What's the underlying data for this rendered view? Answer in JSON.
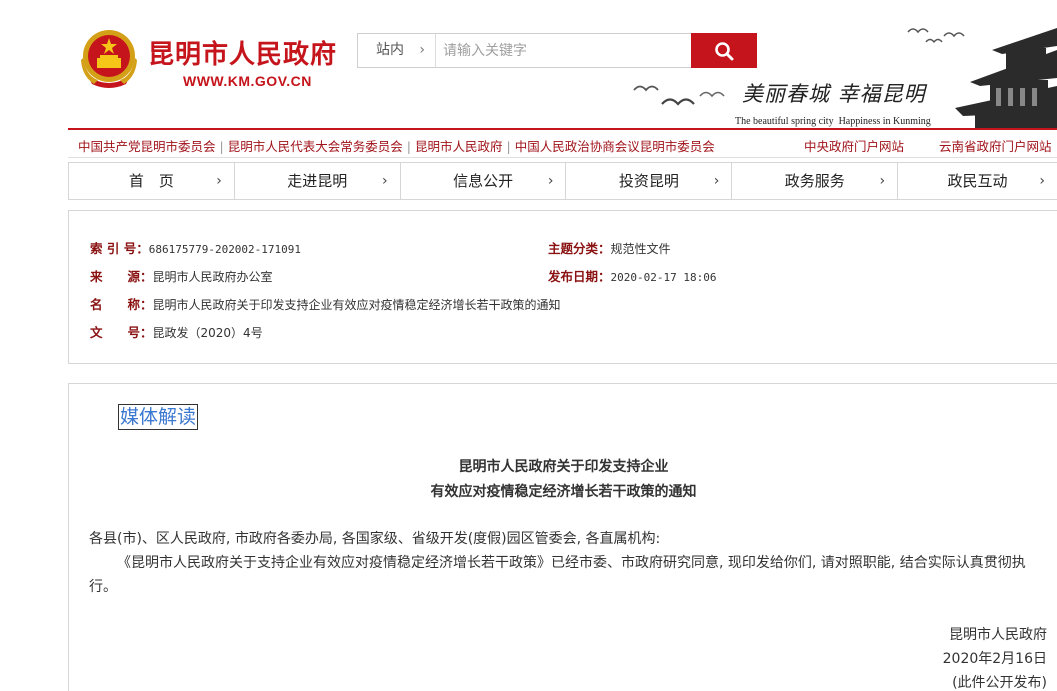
{
  "header": {
    "site_title": "昆明市人民政府",
    "site_url": "WWW.KM.GOV.CN",
    "search": {
      "scope": "站内",
      "placeholder": "请输入关键字"
    },
    "slogan_cn": "美丽春城  幸福昆明",
    "slogan_en": "The beautiful spring city  Happiness in Kunming"
  },
  "toplinks": {
    "left": [
      "中国共产党昆明市委员会",
      "昆明市人民代表大会常务委员会",
      "昆明市人民政府",
      "中国人民政治协商会议昆明市委员会"
    ],
    "right": [
      "中央政府门户网站",
      "云南省政府门户网站"
    ]
  },
  "nav": [
    "首　页",
    "走进昆明",
    "信息公开",
    "投资昆明",
    "政务服务",
    "政民互动"
  ],
  "info": {
    "index_label": "索 引 号：",
    "index_value": "686175779-202002-171091",
    "topic_label": "主题分类：",
    "topic_value": "规范性文件",
    "source_label": "来　　源：",
    "source_value": "昆明市人民政府办公室",
    "date_label": "发布日期：",
    "date_value": "2020-02-17 18:06",
    "name_label": "名　　称：",
    "name_value": "昆明市人民政府关于印发支持企业有效应对疫情稳定经济增长若干政策的通知",
    "doc_label": "文　　号：",
    "doc_value": "昆政发（2020）4号"
  },
  "article": {
    "media_link": "媒体解读",
    "title_line1": "昆明市人民政府关于印发支持企业",
    "title_line2": "有效应对疫情稳定经济增长若干政策的通知",
    "recipients": "各县(市)、区人民政府, 市政府各委办局, 各国家级、省级开发(度假)园区管委会, 各直属机构:",
    "body_line1": "《昆明市人民政府关于支持企业有效应对疫情稳定经济增长若干政策》已经市委、市政府研究同意, 现印发给你们, 请对照职能, 结合实际认真贯彻执",
    "body_line2": "行。",
    "sign_org": "昆明市人民政府",
    "sign_date": "2020年2月16日",
    "sign_note": "(此件公开发布)"
  },
  "colors": {
    "brand_red": "#c5141b",
    "label_red": "#8a1212",
    "link_blue": "#3b78d0"
  },
  "icons": [
    "national-emblem-icon",
    "search-icon",
    "chevron-right-icon"
  ]
}
